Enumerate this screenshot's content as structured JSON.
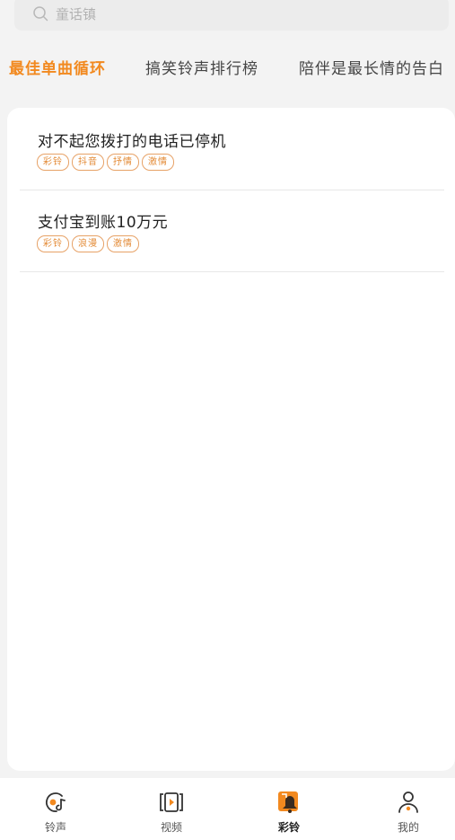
{
  "search": {
    "placeholder": "童话镇",
    "icon": "search-icon"
  },
  "tabs": [
    {
      "label": "最佳单曲循环",
      "active": true
    },
    {
      "label": "搞笑铃声排行榜",
      "active": false
    },
    {
      "label": "陪伴是最长情的告白",
      "active": false
    }
  ],
  "list": [
    {
      "title": "对不起您拨打的电话已停机",
      "tags": [
        "彩铃",
        "抖音",
        "抒情",
        "激情"
      ]
    },
    {
      "title": "支付宝到账10万元",
      "tags": [
        "彩铃",
        "浪漫",
        "激情"
      ]
    }
  ],
  "bottom_nav": [
    {
      "label": "铃声",
      "icon": "ringtone-icon",
      "active": false
    },
    {
      "label": "视频",
      "icon": "video-icon",
      "active": false
    },
    {
      "label": "彩铃",
      "icon": "color-ring-icon",
      "active": true
    },
    {
      "label": "我的",
      "icon": "profile-icon",
      "active": false
    }
  ],
  "colors": {
    "accent": "#f2891f",
    "tag": "#e38a35"
  }
}
